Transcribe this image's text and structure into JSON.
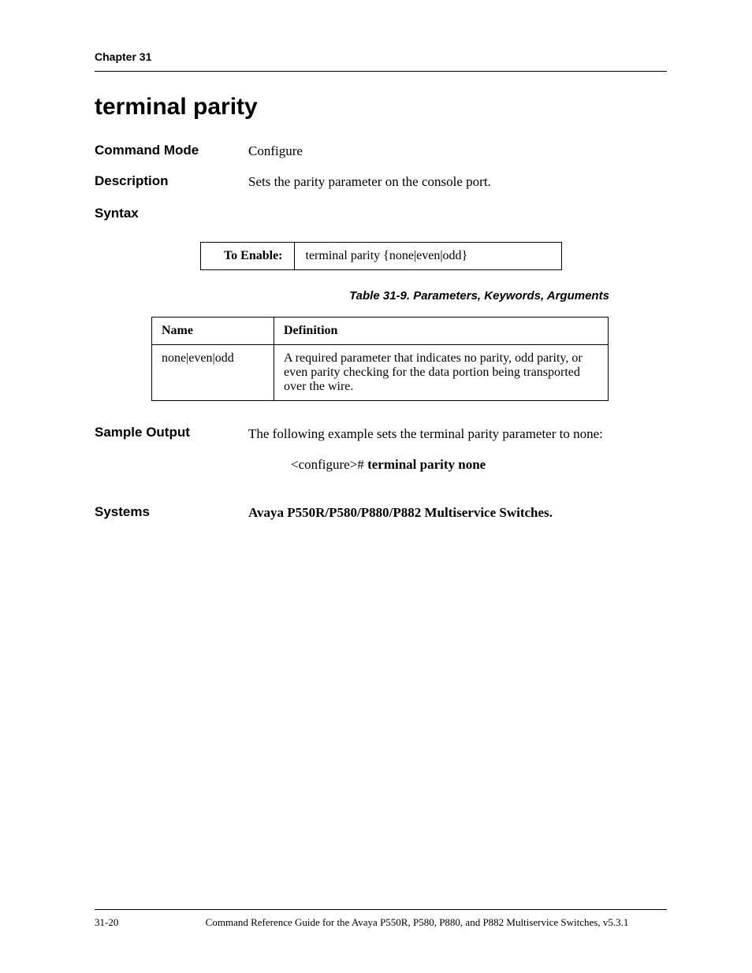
{
  "header": {
    "chapter": "Chapter 31"
  },
  "title": "terminal parity",
  "rows": {
    "command_mode": {
      "label": "Command Mode",
      "value": "Configure"
    },
    "description": {
      "label": "Description",
      "value": "Sets the parity parameter on the console port."
    },
    "syntax": {
      "label": "Syntax"
    },
    "sample": {
      "label": "Sample Output",
      "intro": "The following example sets the terminal parity parameter to none:",
      "prompt": "<configure># ",
      "cmd": "terminal parity none"
    },
    "systems": {
      "label": "Systems",
      "value": "Avaya P550R/P580/P880/P882 Multiservice Switches."
    }
  },
  "enable_table": {
    "label": "To Enable:",
    "value": "terminal parity {none|even|odd}"
  },
  "param_caption": "Table 31-9.  Parameters, Keywords, Arguments",
  "param_table": {
    "headers": {
      "name": "Name",
      "definition": "Definition"
    },
    "rows": [
      {
        "name": "none|even|odd",
        "definition": "A required parameter that indicates no parity, odd parity, or even parity checking for the data portion being transported over the wire."
      }
    ]
  },
  "footer": {
    "page": "31-20",
    "text": "Command Reference Guide for the Avaya P550R, P580, P880, and P882 Multiservice Switches, v5.3.1"
  }
}
